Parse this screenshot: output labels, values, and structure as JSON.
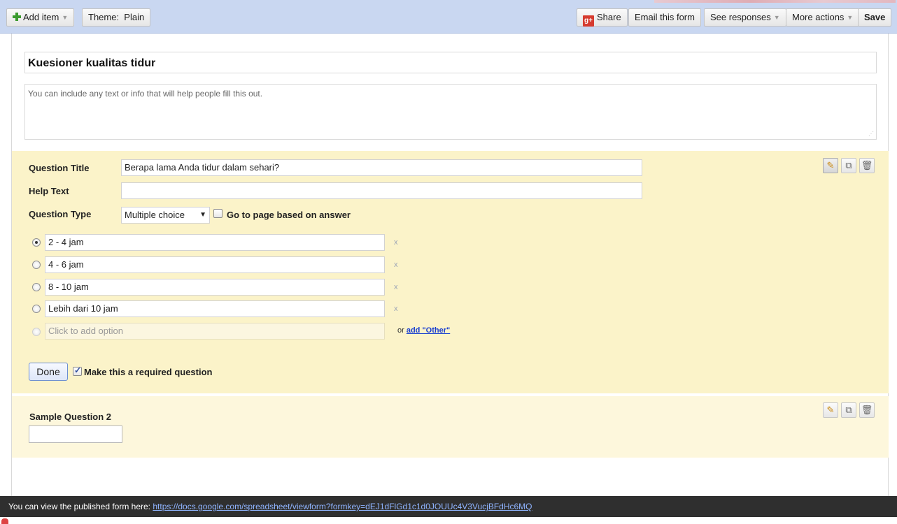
{
  "toolbar": {
    "add_item": "Add item",
    "theme": "Theme:  Plain",
    "share": "Share",
    "email_form": "Email this form",
    "see_responses": "See responses",
    "more_actions": "More actions",
    "save": "Save",
    "caret": "▼"
  },
  "form": {
    "title": "Kuesioner kualitas tidur",
    "description_placeholder": "You can include any text or info that will help people fill this out."
  },
  "question1": {
    "title_label": "Question Title",
    "title_value": "Berapa lama Anda tidur dalam sehari?",
    "help_label": "Help Text",
    "help_value": "",
    "type_label": "Question Type",
    "type_value": "Multiple choice",
    "goto_page_label": "Go to page based on answer",
    "options": [
      "2 - 4 jam",
      "4 - 6 jam",
      "8 - 10 jam",
      "Lebih dari 10 jam"
    ],
    "remove_symbol": "x",
    "add_option_placeholder": "Click to add option",
    "or_text": "or",
    "add_other_link": "add \"Other\"",
    "done_label": "Done",
    "required_label": "Make this a required question"
  },
  "question2": {
    "title": "Sample Question 2"
  },
  "footer": {
    "published_text": "You can view the published form here:",
    "published_url": "https://docs.google.com/spreadsheet/viewform?formkey=dEJ1dFlGd1c1d0JOUUc4V3VucjBFdHc6MQ"
  },
  "icons": {
    "add": "plus-icon",
    "gplus": "g+",
    "edit": "pencil-icon",
    "duplicate": "duplicate-icon",
    "delete": "trash-icon"
  },
  "colors": {
    "toolbar_bg": "#c9d7f1",
    "active_question_bg": "#fbf3c9",
    "link": "#1a3fd0",
    "footer_bg": "#2f2f2f"
  }
}
